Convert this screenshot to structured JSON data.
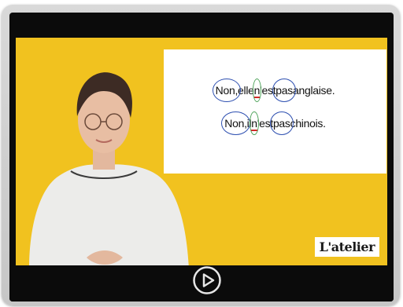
{
  "video": {
    "slide": {
      "sentence1": {
        "word1": "Non,",
        "word2": "elle",
        "word3_neg": "n",
        "word3_rest": "'est",
        "word4": "pas",
        "word5": "anglaise."
      },
      "sentence2": {
        "word1": "Non,",
        "word2": "il",
        "word3_neg": "n",
        "word3_rest": "'est",
        "word4": "pas",
        "word5": "chinois."
      }
    },
    "logo_text": "L'atelier"
  },
  "controls": {
    "play_icon": "play-circle-icon"
  },
  "colors": {
    "background_yellow": "#f1c21f",
    "circle_blue": "#2d4fb0",
    "circle_green": "#4ea35a",
    "underline_red": "#d32a2a"
  }
}
